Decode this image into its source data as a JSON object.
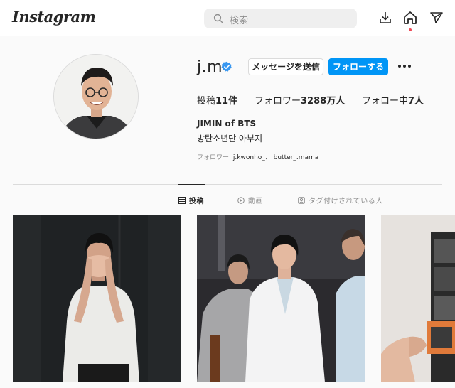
{
  "header": {
    "logo": "Instagram",
    "search_placeholder": "検索",
    "icons": [
      "search-icon",
      "inbox-icon",
      "home-icon",
      "explore-icon"
    ]
  },
  "profile": {
    "username": "j.m",
    "verified": true,
    "message_button": "メッセージを送信",
    "follow_button": "フォローする",
    "stats": {
      "posts_label": "投稿",
      "posts_count": "11件",
      "followers_label": "フォロワー",
      "followers_count": "3288万人",
      "following_label": "フォロー中",
      "following_count": "7人"
    },
    "full_name": "JIMIN of BTS",
    "bio": "방탄소년단 아부지",
    "followed_by_label": "フォロワー:",
    "followed_by_users": "j.kwonho_、 butter_.mama"
  },
  "tabs": [
    {
      "label": "投稿",
      "active": true
    },
    {
      "label": "動画",
      "active": false
    },
    {
      "label": "タグ付けされている人",
      "active": false
    }
  ],
  "colors": {
    "accent": "#0095f6",
    "verified": "#3897f0",
    "notification_dot": "#ed4956",
    "text": "#262626",
    "muted": "#8e8e8e",
    "border": "#dbdbdb"
  }
}
